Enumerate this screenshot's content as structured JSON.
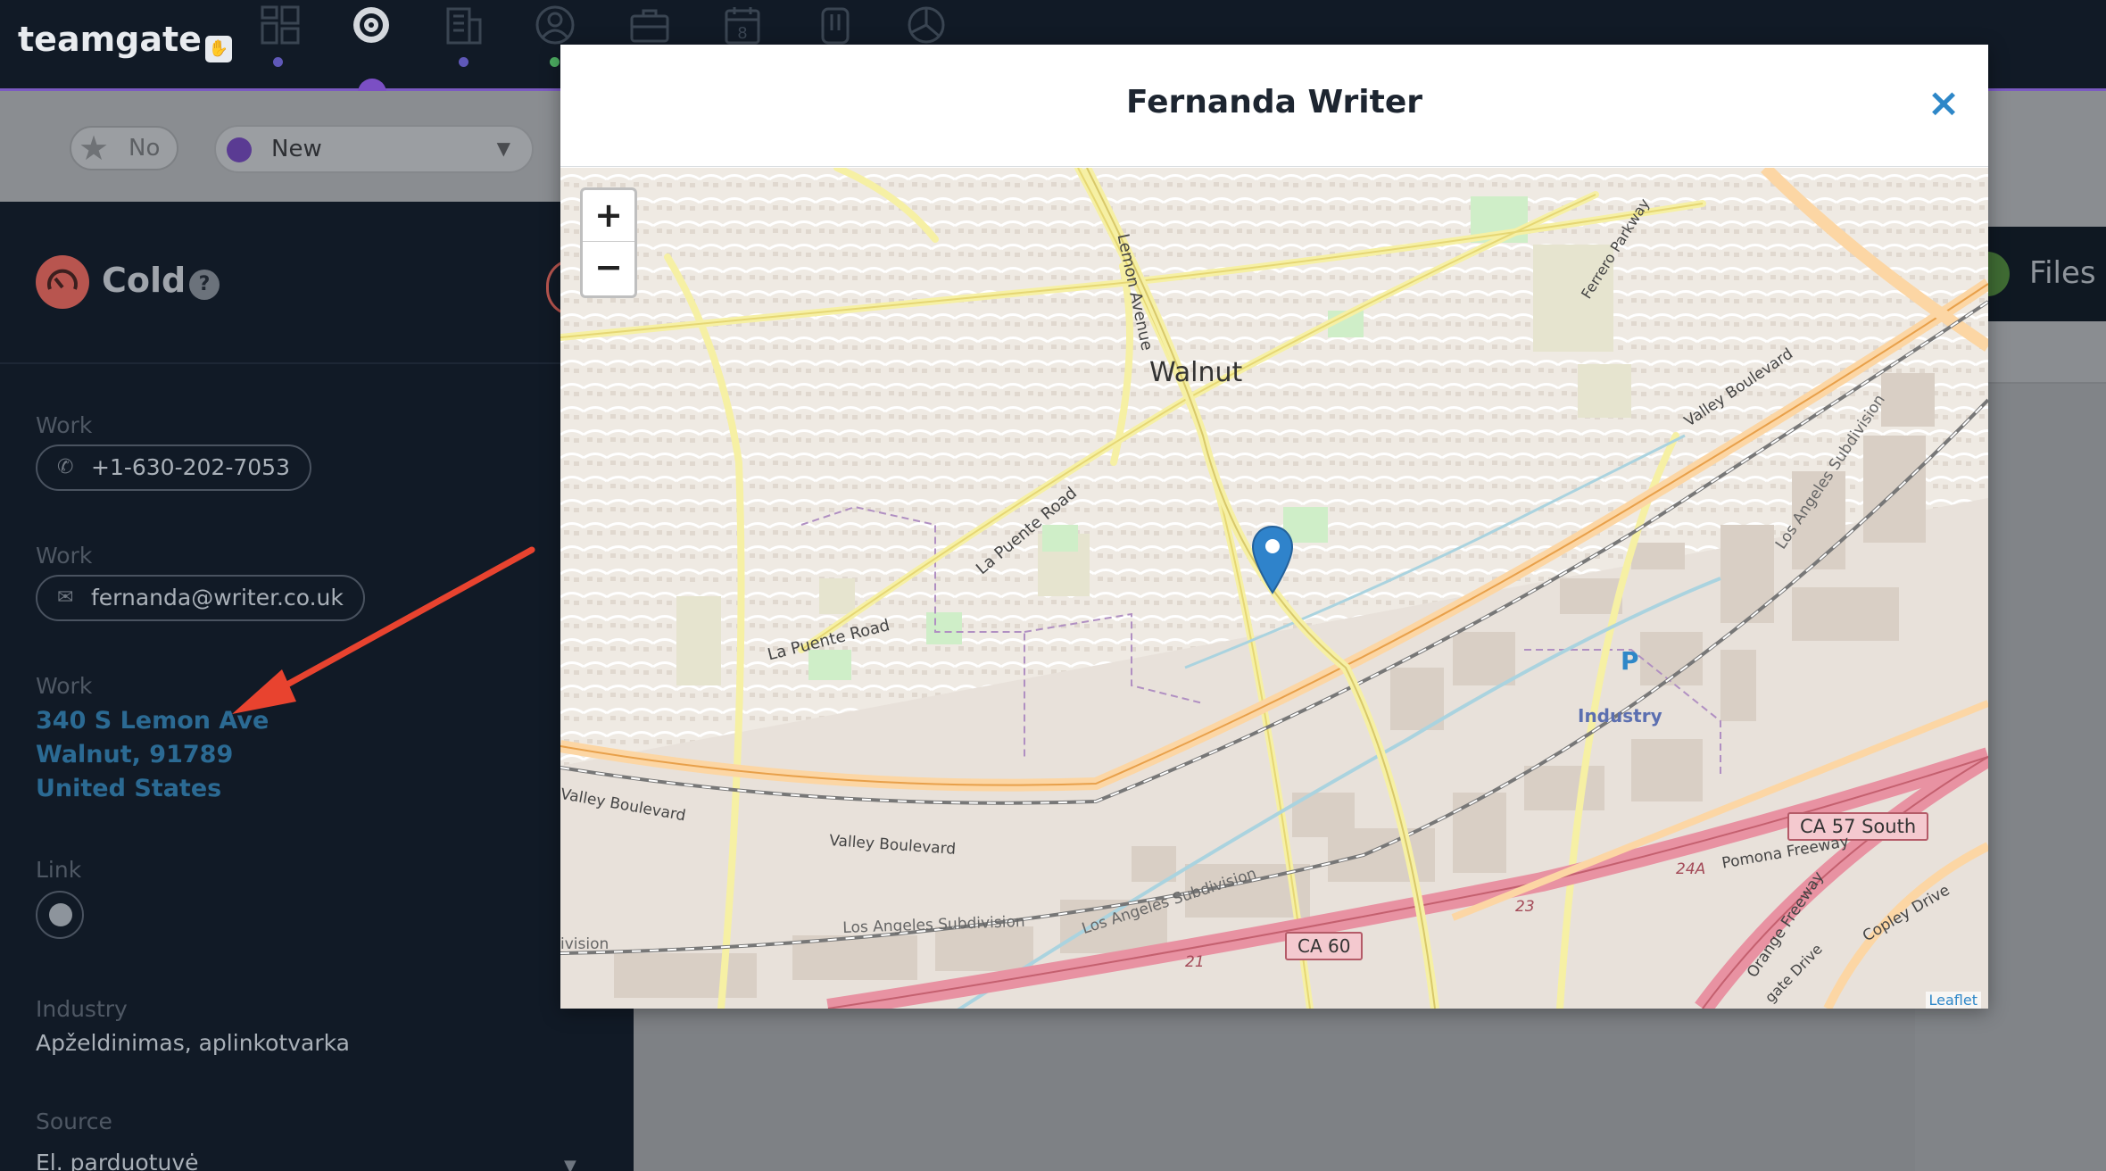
{
  "app": {
    "logo_text": "teamgate",
    "logo_mark": "✋"
  },
  "nav": {
    "icons": [
      "dashboard-icon",
      "target-icon",
      "companies-icon",
      "people-icon",
      "briefcase-icon",
      "calendar-icon",
      "files-icon",
      "reports-icon"
    ],
    "calendar_day": "8",
    "active": "target-icon",
    "accent_color": "#7b4fc4"
  },
  "toolbar": {
    "star_label": "No",
    "status_label": "New",
    "status_color": "#5a3b93"
  },
  "lead": {
    "temperature": "Cold",
    "help_glyph": "?",
    "phone_label": "Work",
    "phone": "+1-630-202-7053",
    "email_label": "Work",
    "email": "fernanda@writer.co.uk",
    "address_label": "Work",
    "address_line1": "340 S Lemon Ave",
    "address_line2": "Walnut, 91789",
    "address_line3": "United States",
    "link_label": "Link",
    "industry_label": "Industry",
    "industry": "Apželdinimas, aplinkotvarka",
    "source_label": "Source",
    "source": "El. parduotuvė"
  },
  "right_panel": {
    "files_label": "Files"
  },
  "modal": {
    "title": "Fernanda Writer",
    "close_glyph": "×",
    "zoom_in": "+",
    "zoom_out": "−",
    "attribution": "Leaflet"
  },
  "map_labels": {
    "city": "Walnut",
    "lemon_avenue": "Lemon Avenue",
    "la_puente_1": "La Puente Road",
    "la_puente_2": "La Puente Road",
    "valley_blvd_1": "Valley Boulevard",
    "valley_blvd_2": "Valley Boulevard",
    "valley_blvd_3": "Valley Boulevard",
    "la_subdivision_1": "Los Angeles Subdivision",
    "la_subdivision_2": "Los Angeles Subdivision",
    "la_subdivision_3": "Los Angeles Subdivision",
    "industry": "Industry",
    "parking": "P",
    "ca57_south": "CA 57 South",
    "pomona_fwy": "Pomona Freeway",
    "orange_fwy": "Orange Freeway",
    "copley_drive": "Copley Drive",
    "ca60": "CA 60",
    "exit_24a": "24A",
    "exit_23": "23",
    "exit_21": "21",
    "ferrero_parkway": "Ferrero Parkway",
    "gate_drive": "gate Drive",
    "division": "ivision"
  }
}
